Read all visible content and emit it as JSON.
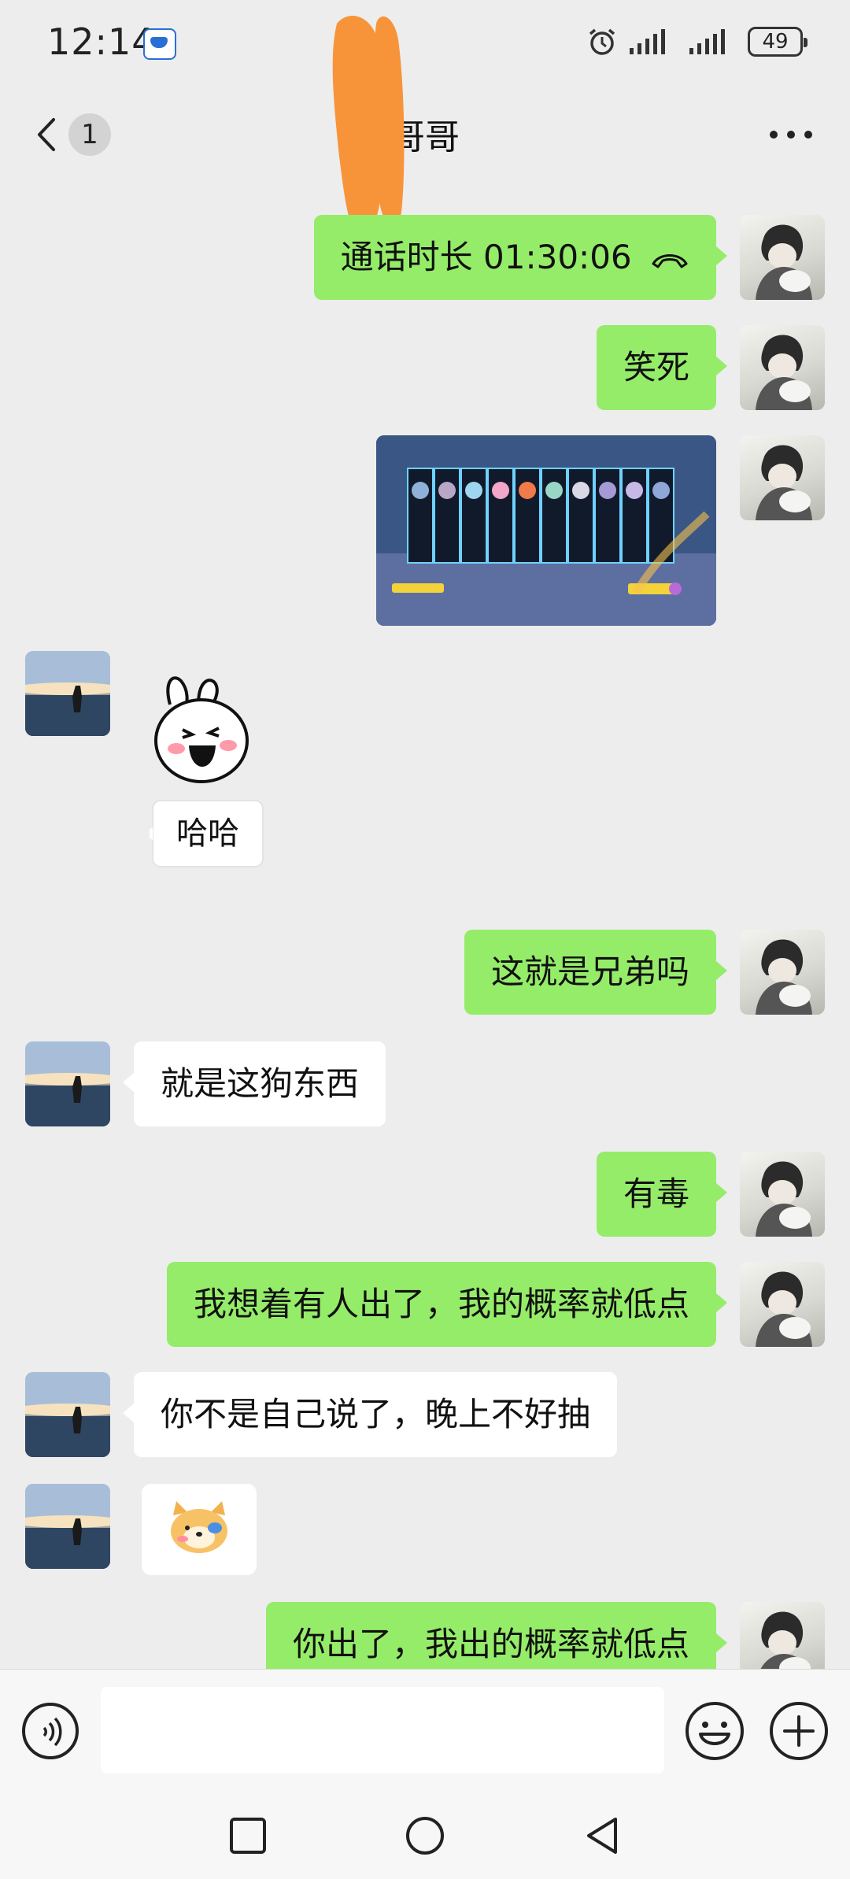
{
  "status_bar": {
    "time": "12:14",
    "battery": "49",
    "icons": [
      "app-notification-icon",
      "alarm-icon",
      "signal-icon",
      "signal-icon",
      "battery-icon"
    ]
  },
  "header": {
    "unread_count": "1",
    "title": "哥哥"
  },
  "messages": [
    {
      "side": "self",
      "type": "call",
      "text": "通话时长 01:30:06"
    },
    {
      "side": "self",
      "type": "text",
      "text": "笑死"
    },
    {
      "side": "self",
      "type": "image",
      "text": ""
    },
    {
      "side": "other",
      "type": "sticker",
      "text": "哈哈"
    },
    {
      "side": "self",
      "type": "text",
      "text": "这就是兄弟吗"
    },
    {
      "side": "other",
      "type": "text",
      "text": "就是这狗东西"
    },
    {
      "side": "self",
      "type": "text",
      "text": "有毒"
    },
    {
      "side": "self",
      "type": "text",
      "text": "我想着有人出了，我的概率就低点"
    },
    {
      "side": "other",
      "type": "text",
      "text": "你不是自己说了，晚上不好抽"
    },
    {
      "side": "other",
      "type": "emoji",
      "text": ""
    },
    {
      "side": "self",
      "type": "text",
      "text": "你出了，我出的概率就低点"
    }
  ],
  "input_bar": {
    "value": "",
    "icons": [
      "voice-icon",
      "emoji-icon",
      "plus-icon"
    ]
  },
  "system_nav": {
    "icons": [
      "recent-apps-icon",
      "home-icon",
      "back-icon"
    ]
  },
  "colors": {
    "background": "#ededed",
    "self_bubble": "#95ec69",
    "other_bubble": "#ffffff",
    "redaction": "#f7943a"
  }
}
